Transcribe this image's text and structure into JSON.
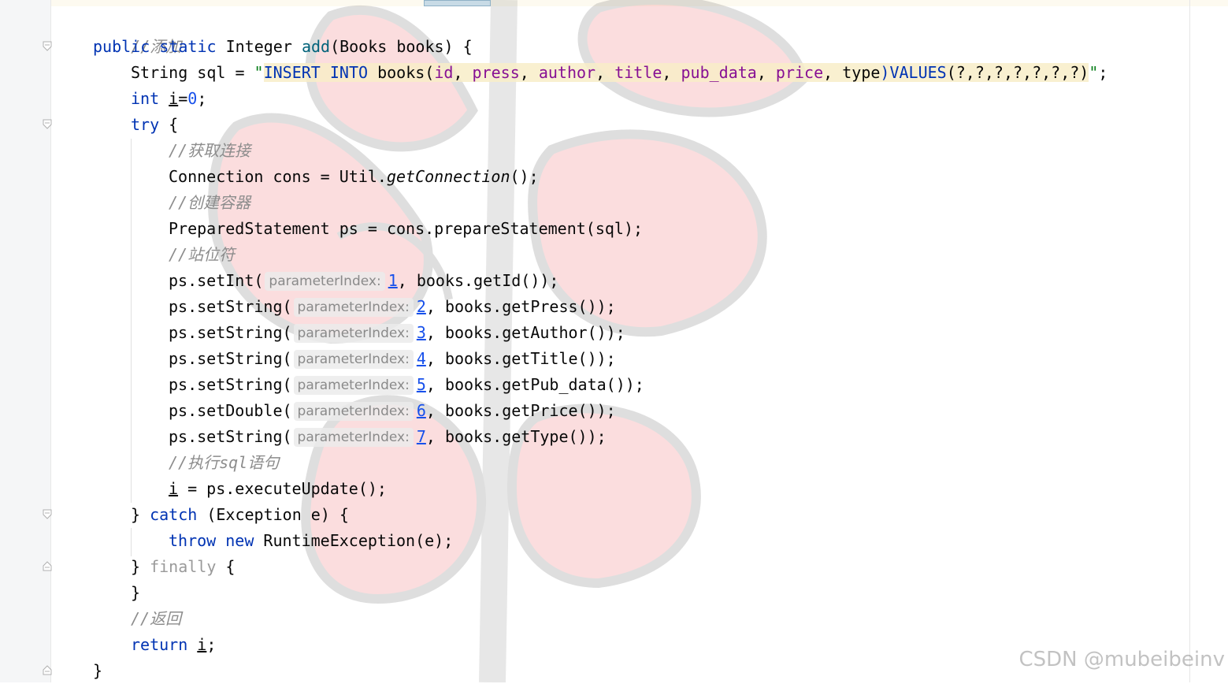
{
  "editor": {
    "lines": [
      {
        "comment": "//添加"
      },
      {
        "kw1": "public",
        "kw2": "static",
        "type": "Integer",
        "method": "add",
        "params": "(Books books) {"
      },
      {
        "pre": "String sql = ",
        "quote_open": "\"",
        "sql_insert": "INSERT INTO",
        "sql_table": " books(",
        "c1": "id",
        "sep1": ", ",
        "c2": "press",
        "sep2": ", ",
        "c3": "author",
        "sep3": ", ",
        "c4": "title",
        "sep4": ", ",
        "c5": "pub_data",
        "sep5": ", ",
        "c6": "price",
        "sep6": ", ",
        "c7": "type",
        "sql_values_kw": ")VALUES",
        "sql_values": "(?,?,?,?,?,?,?)",
        "quote_close": "\"",
        "end": ";"
      },
      {
        "kw": "int",
        "var": "i",
        "eq": "=",
        "num": "0",
        "end": ";"
      },
      {
        "kw": "try",
        "rest": " {"
      },
      {
        "comment": "//获取连接"
      },
      {
        "pre": "Connection cons = Util.",
        "call": "getConnection",
        "post": "();"
      },
      {
        "comment": "//创建容器"
      },
      {
        "text": "PreparedStatement ps = cons.prepareStatement(sql);"
      },
      {
        "comment": "//站位符"
      },
      {
        "pre": "ps.setInt(",
        "hint": "parameterIndex:",
        "num": "1",
        "post": ", books.getId());"
      },
      {
        "pre": "ps.setString(",
        "hint": "parameterIndex:",
        "num": "2",
        "post": ", books.getPress());"
      },
      {
        "pre": "ps.setString(",
        "hint": "parameterIndex:",
        "num": "3",
        "post": ", books.getAuthor());"
      },
      {
        "pre": "ps.setString(",
        "hint": "parameterIndex:",
        "num": "4",
        "post": ", books.getTitle());"
      },
      {
        "pre": "ps.setString(",
        "hint": "parameterIndex:",
        "num": "5",
        "post": ", books.getPub_data());"
      },
      {
        "pre": "ps.setDouble(",
        "hint": "parameterIndex:",
        "num": "6",
        "post": ", books.getPrice());"
      },
      {
        "pre": "ps.setString(",
        "hint": "parameterIndex:",
        "num": "7",
        "post": ", books.getType());"
      },
      {
        "comment": "//执行sql语句"
      },
      {
        "var": "i",
        "rest": " = ps.executeUpdate();"
      },
      {
        "pre": "} ",
        "kw": "catch",
        "rest": " (Exception e) {"
      },
      {
        "kw1": "throw",
        "kw2": "new",
        "rest": " RuntimeException(e);"
      },
      {
        "pre": "} ",
        "kw": "finally",
        "rest": " {"
      },
      {
        "text": "}"
      },
      {
        "comment": "//返回"
      },
      {
        "kw": "return",
        "var": "i",
        "end": ";"
      },
      {
        "text": "}"
      }
    ]
  },
  "watermark": "CSDN @mubeibeinv",
  "colors": {
    "keyword": "#0033b3",
    "method": "#00627a",
    "comment": "#8c8c8c",
    "string": "#067d17",
    "number": "#1750eb",
    "field": "#871094",
    "gutter": "#f5f6f7"
  }
}
